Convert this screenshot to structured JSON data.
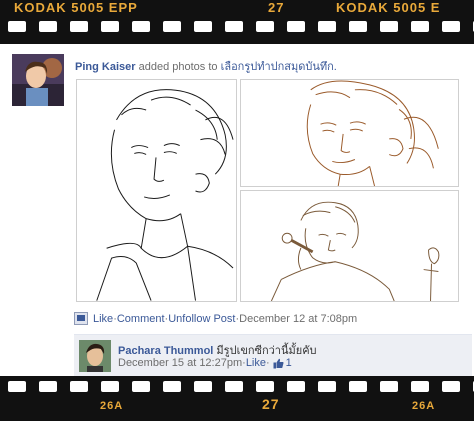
{
  "film": {
    "top_left": "KODAK 5005 EPP",
    "top_center": "27",
    "top_right": "KODAK 5005 E",
    "bottom_left": "26A",
    "bottom_center": "27",
    "bottom_right": "26A"
  },
  "post": {
    "author": "Ping Kaiser",
    "action_text": "added photos to",
    "album": "เลือกรูปทำปกสมุดบันทึก.",
    "like_label": "Like",
    "comment_label": "Comment",
    "unfollow_label": "Unfollow Post",
    "timestamp": "December 12 at 7:08pm",
    "separator": " · "
  },
  "comment": {
    "author": "Pachara Thummol",
    "text": "มีรูปเขกซีกว่านี้มั้ยคับ",
    "timestamp": "December 15 at 12:27pm",
    "like_label": "Like",
    "like_count": "1"
  },
  "icons": {
    "like": "like-icon",
    "thumb": "thumbs-up-icon"
  },
  "colors": {
    "link": "#3b5998",
    "film": "#111111",
    "film_text": "#e9a93a",
    "comment_bg": "#edeff4"
  }
}
